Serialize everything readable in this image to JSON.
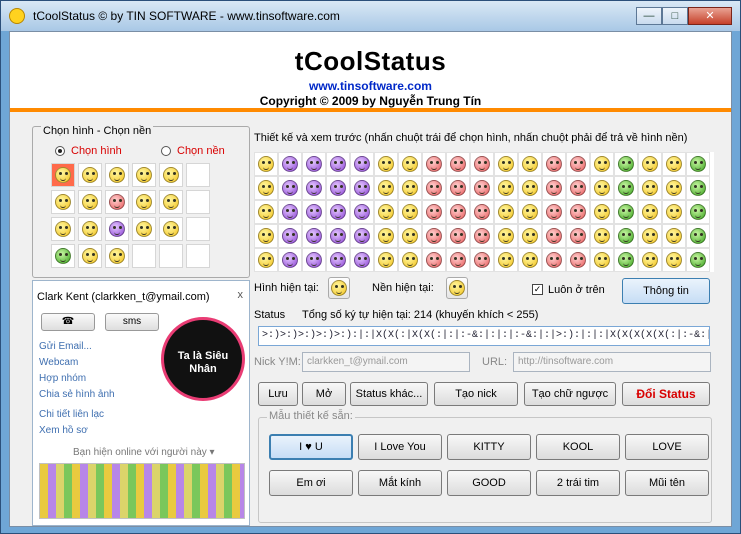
{
  "window": {
    "title": "tCoolStatus © by TIN SOFTWARE - www.tinsoftware.com",
    "min_label": "—",
    "max_label": "□",
    "close_label": "✕"
  },
  "header": {
    "title": "tCoolStatus",
    "url": "www.tinsoftware.com",
    "copyright": "Copyright © 2009 by Nguyễn Trung Tín"
  },
  "left": {
    "group_label": "Chọn hình - Chọn nền",
    "radio_pick_image": "Chọn hình",
    "radio_pick_bg": "Chọn nền",
    "mini_faces": [
      "red-bg",
      "yellow",
      "yellow",
      "yellow",
      "yellow",
      "empty",
      "yellow",
      "yellow",
      "red",
      "yellow",
      "yellow",
      "empty",
      "yellow",
      "yellow",
      "purple",
      "yellow",
      "yellow",
      "empty",
      "green",
      "yellow",
      "yellow",
      "empty",
      "empty",
      "empty"
    ]
  },
  "chat": {
    "contact": "Clark Kent (clarkken_t@ymail.com)",
    "close": "x",
    "sms": "sms",
    "links": [
      "Gửi Email...",
      "Webcam",
      "Hợp nhóm",
      "Chia sẻ hình ảnh",
      "Chi tiết liên lạc",
      "Xem hồ sơ"
    ],
    "mascot_text": "Ta là Siêu Nhân",
    "online_label": "Bạn hiện online với người này ▾"
  },
  "design": {
    "heading": "Thiết kế và xem trước (nhấn chuột trái để chọn hình, nhấn chuột phải để trả về hình nền)",
    "grid_rows": [
      [
        "yellow",
        "purple",
        "purple",
        "purple",
        "purple",
        "yellow",
        "yellow",
        "red",
        "red",
        "red",
        "yellow",
        "yellow",
        "red",
        "red",
        "yellow",
        "green",
        "yellow",
        "yellow",
        "green"
      ],
      [
        "yellow",
        "purple",
        "purple",
        "purple",
        "purple",
        "yellow",
        "yellow",
        "red",
        "red",
        "red",
        "yellow",
        "yellow",
        "red",
        "red",
        "yellow",
        "green",
        "yellow",
        "yellow",
        "green"
      ],
      [
        "yellow",
        "purple",
        "purple",
        "purple",
        "purple",
        "yellow",
        "yellow",
        "red",
        "red",
        "red",
        "yellow",
        "yellow",
        "red",
        "red",
        "yellow",
        "green",
        "yellow",
        "yellow",
        "green"
      ],
      [
        "yellow",
        "purple",
        "purple",
        "purple",
        "purple",
        "yellow",
        "yellow",
        "red",
        "red",
        "red",
        "yellow",
        "yellow",
        "red",
        "red",
        "yellow",
        "green",
        "yellow",
        "yellow",
        "green"
      ],
      [
        "yellow",
        "purple",
        "purple",
        "purple",
        "purple",
        "yellow",
        "yellow",
        "red",
        "red",
        "red",
        "yellow",
        "yellow",
        "red",
        "red",
        "yellow",
        "green",
        "yellow",
        "yellow",
        "green"
      ]
    ],
    "current_image_label": "Hình hiện tại:",
    "current_bg_label": "Nền hiện tại:",
    "always_on_top": "Luôn ở trên",
    "info_button": "Thông tin",
    "status_label": "Status",
    "char_count": "Tổng số ký tự hiện tại: 214 (khuyến khích < 255)",
    "status_value": ">:)>:)>:)>:)>:):|:|X(X(:|X(X(:|:|:-&:|:|:|:-&:|:|>:):|:|:|X(X(X(X(X(:|:-&:|:|:|:-&:|:|:-&:|:|>:)"
  },
  "fields": {
    "nick_label": "Nick Y!M:",
    "nick_value": "clarkken_t@ymail.com",
    "url_label": "URL:",
    "url_value": "http://tinsoftware.com"
  },
  "actions": [
    "Lưu",
    "Mở",
    "Status khác...",
    "Tạo nick",
    "Tạo chữ ngược",
    "Đổi Status"
  ],
  "samples": {
    "label": "Mẫu thiết kế sẵn:",
    "buttons": [
      "I ♥ U",
      "I Love You",
      "KITTY",
      "KOOL",
      "LOVE",
      "Em ơi",
      "Mắt kính",
      "GOOD",
      "2 trái tim",
      "Mũi tên"
    ]
  }
}
